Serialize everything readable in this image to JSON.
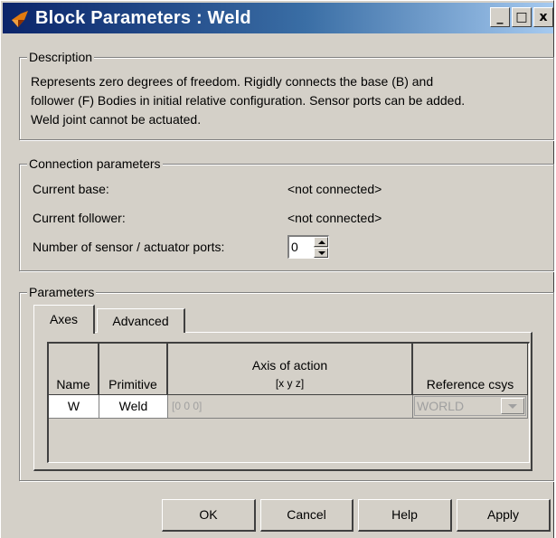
{
  "window": {
    "title": "Block Parameters : Weld",
    "minimize": "_",
    "maximize": "□",
    "close": "x"
  },
  "description": {
    "title": "Description",
    "lines": [
      "Represents zero degrees of freedom. Rigidly connects the base (B) and",
      "follower (F) Bodies in initial relative configuration. Sensor ports can be added.",
      "Weld joint cannot be actuated."
    ]
  },
  "connection": {
    "title": "Connection parameters",
    "base_label": "Current base:",
    "base_value": "<not connected>",
    "follower_label": "Current follower:",
    "follower_value": "<not connected>",
    "ports_label": "Number of sensor / actuator ports:",
    "ports_value": "0"
  },
  "parameters": {
    "title": "Parameters",
    "tabs": [
      {
        "label": "Axes",
        "selected": true
      },
      {
        "label": "Advanced",
        "selected": false
      }
    ],
    "table": {
      "headers": {
        "name": "Name",
        "primitive": "Primitive",
        "axis_line1": "Axis of action",
        "axis_line2": "[x y z]",
        "ref": "Reference csys"
      },
      "row": {
        "name": "W",
        "primitive": "Weld",
        "axis": "[0 0 0]",
        "ref": "WORLD"
      }
    }
  },
  "buttons": {
    "ok": "OK",
    "cancel": "Cancel",
    "help": "Help",
    "apply": "Apply"
  },
  "colors": {
    "face": "#d4d0c8",
    "title_start": "#0a246a",
    "title_end": "#a6caf0",
    "disabled_text": "#a0a0a0"
  },
  "icons": {
    "title": "simmechanics-block-icon"
  }
}
